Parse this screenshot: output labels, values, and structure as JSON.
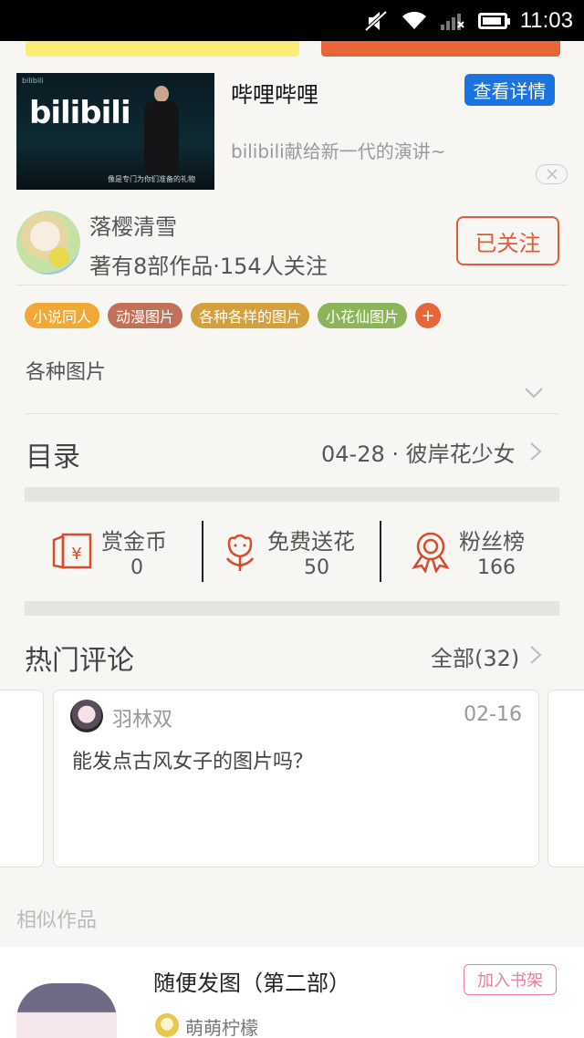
{
  "status_bar": {
    "time": "11:03",
    "battery_level": 0.9
  },
  "ad": {
    "title": "哔哩哔哩",
    "button_label": "查看详情",
    "description": "bilibili献给新一代的演讲~",
    "thumb_logo": "bilibili",
    "thumb_caption": "像是专门为你们准备的礼物",
    "close_icon": "close-icon"
  },
  "author": {
    "name": "落樱清雪",
    "stats": "著有8部作品·154人关注",
    "follow_label": "已关注"
  },
  "tags": [
    {
      "label": "小说同人",
      "color": "#f0a934"
    },
    {
      "label": "动漫图片",
      "color": "#c2705a"
    },
    {
      "label": "各种各样的图片",
      "color": "#d2a03e"
    },
    {
      "label": "小花仙图片",
      "color": "#8db45a"
    }
  ],
  "tag_add_label": "+",
  "description": "各种图片",
  "toc": {
    "label": "目录",
    "latest": "04-28 · 彼岸花少女"
  },
  "stats": [
    {
      "label": "赏金币",
      "value": "0",
      "icon": "red-envelope-icon"
    },
    {
      "label": "免费送花",
      "value": "50",
      "icon": "flower-icon"
    },
    {
      "label": "粉丝榜",
      "value": "166",
      "icon": "award-badge-icon"
    }
  ],
  "comments": {
    "label": "热门评论",
    "all_label": "全部(32)",
    "items": [
      {
        "user": "羽林双",
        "date": "02-16",
        "text": "能发点古风女子的图片吗？"
      }
    ]
  },
  "similar": {
    "label": "相似作品",
    "item": {
      "title": "随便发图（第二部）",
      "button_label": "加入书架",
      "author": "萌萌柠檬"
    }
  },
  "colors": {
    "accent": "#e55a3a",
    "link_blue": "#1a73e0",
    "pink": "#f07aa0"
  }
}
